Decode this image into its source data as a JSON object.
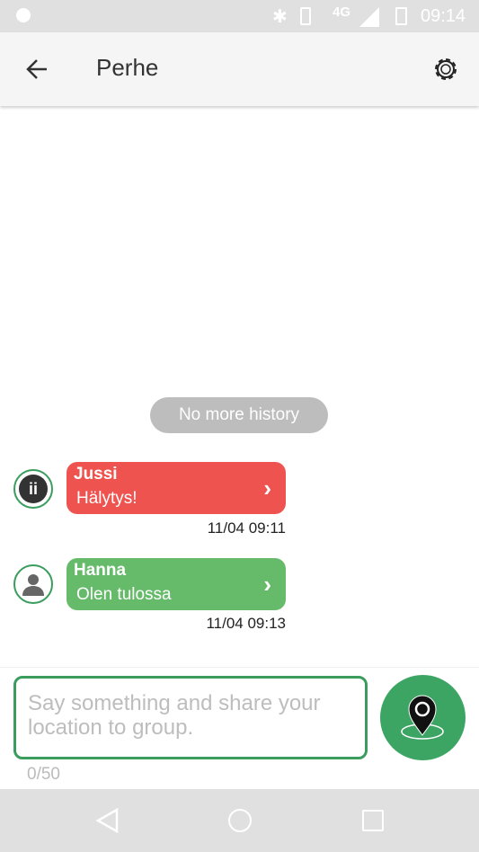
{
  "status_bar": {
    "network": "4G",
    "time": "09:14",
    "icons": [
      "app-notification-icon",
      "bluetooth-icon",
      "vibrate-icon",
      "signal-icon",
      "battery-icon"
    ]
  },
  "app_bar": {
    "title": "Perhe",
    "back_icon": "arrow-left-icon",
    "settings_icon": "gear-icon"
  },
  "history_label": "No more history",
  "messages": [
    {
      "sender": "Jussi",
      "text": "Hälytys!",
      "time": "11/04 09:11",
      "color": "#ef5350",
      "avatar": "app-logo-avatar"
    },
    {
      "sender": "Hanna",
      "text": "Olen tulossa",
      "time": "11/04 09:13",
      "color": "#66bb6a",
      "avatar": "person-avatar"
    }
  ],
  "composer": {
    "placeholder": "Say something and share your location to group.",
    "counter": "0/50",
    "accent": "#3a9d5d",
    "share_icon": "location-pin-icon"
  },
  "nav_bar": {
    "icons": [
      "back-triangle-icon",
      "home-circle-icon",
      "recents-square-icon"
    ]
  }
}
